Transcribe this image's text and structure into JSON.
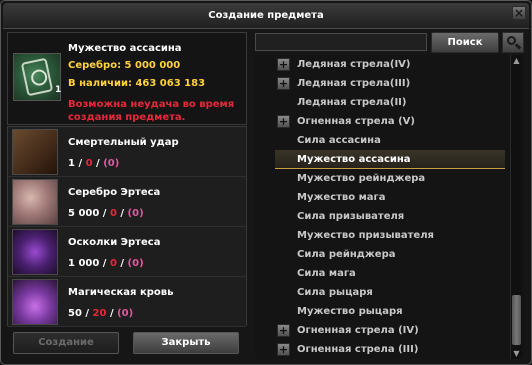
{
  "window": {
    "title": "Создание предмета"
  },
  "item": {
    "name": "Мужество ассасина",
    "silver": "Серебро: 5 000 000",
    "have": "В наличии: 463 063 183",
    "count": "1",
    "warning": "Возможна неудача во время создания предмета."
  },
  "materials": [
    {
      "name": "Смертельный удар",
      "have": "1",
      "need": "0",
      "extra": "(0)",
      "icon": "book-icon"
    },
    {
      "name": "Серебро Эртеса",
      "have": "5 000",
      "need": "0",
      "extra": "(0)",
      "icon": "coins-icon"
    },
    {
      "name": "Осколки Эртеса",
      "have": "1 000",
      "need": "0",
      "extra": "(0)",
      "icon": "shards-icon"
    },
    {
      "name": "Магическая кровь",
      "have": "50",
      "need": "20",
      "extra": "(0)",
      "icon": "potion-icon"
    }
  ],
  "buttons": {
    "create": "Создание",
    "close": "Закрыть",
    "search": "Поиск"
  },
  "search": {
    "value": ""
  },
  "list": [
    {
      "label": "Ледяная стрела(IV)",
      "expandable": true,
      "selected": false
    },
    {
      "label": "Ледяная стрела(III)",
      "expandable": true,
      "selected": false
    },
    {
      "label": "Ледяная стрела(II)",
      "expandable": false,
      "selected": false
    },
    {
      "label": "Огненная стрела (V)",
      "expandable": true,
      "selected": false
    },
    {
      "label": "Сила ассасина",
      "expandable": false,
      "selected": false
    },
    {
      "label": "Мужество ассасина",
      "expandable": false,
      "selected": true
    },
    {
      "label": "Мужество рейнджера",
      "expandable": false,
      "selected": false
    },
    {
      "label": "Мужество мага",
      "expandable": false,
      "selected": false
    },
    {
      "label": "Сила призывателя",
      "expandable": false,
      "selected": false
    },
    {
      "label": "Мужество призывателя",
      "expandable": false,
      "selected": false
    },
    {
      "label": "Сила рейнджера",
      "expandable": false,
      "selected": false
    },
    {
      "label": "Сила мага",
      "expandable": false,
      "selected": false
    },
    {
      "label": "Сила рыцаря",
      "expandable": false,
      "selected": false
    },
    {
      "label": "Мужество рыцаря",
      "expandable": false,
      "selected": false
    },
    {
      "label": "Огненная стрела (IV)",
      "expandable": true,
      "selected": false
    },
    {
      "label": "Огненная стрела (III)",
      "expandable": true,
      "selected": false
    }
  ]
}
